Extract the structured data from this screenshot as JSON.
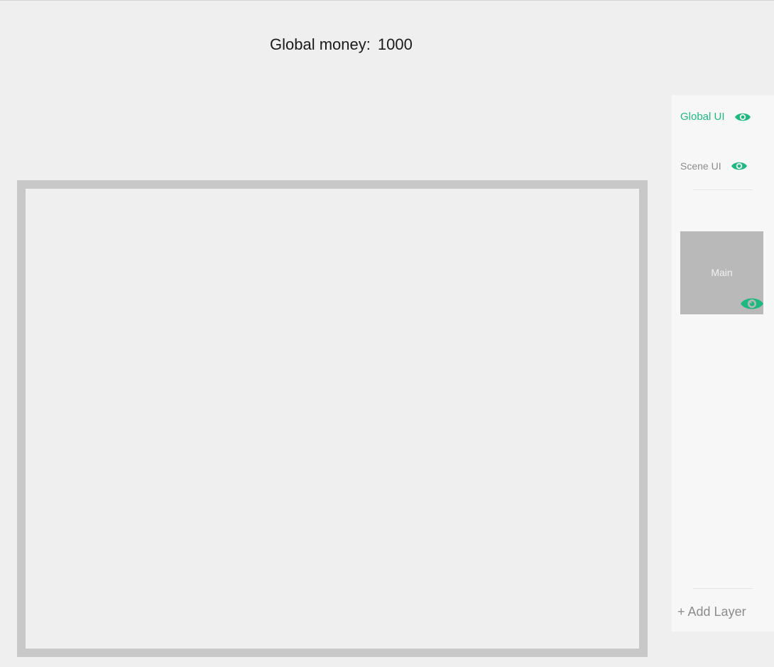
{
  "header": {
    "money_label": "Global money:",
    "money_value": "1000"
  },
  "layers": {
    "items": [
      {
        "label": "Global UI",
        "active": true,
        "icon": "eye-icon"
      },
      {
        "label": "Scene UI",
        "active": false,
        "icon": "eye-icon"
      }
    ],
    "scenes": [
      {
        "label": "Main",
        "icon": "eye-icon"
      }
    ],
    "add_label": "+ Add Layer"
  },
  "colors": {
    "accent": "#1fb980",
    "panel_bg": "#f7f7f7",
    "canvas_border": "#c8c8c8",
    "card_bg": "#b9b9b9",
    "muted_text": "#8c8c8c"
  }
}
